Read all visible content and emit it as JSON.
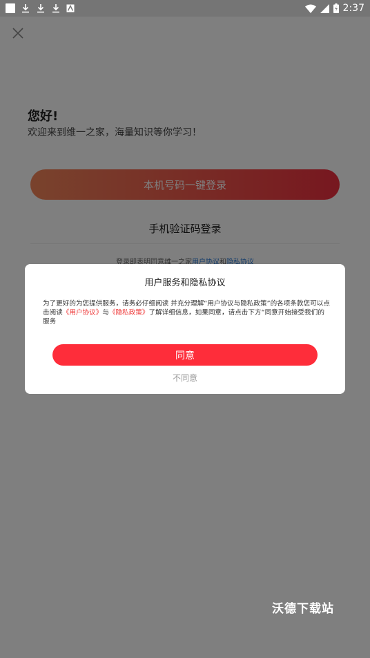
{
  "status_bar": {
    "time": "2:37",
    "icons": [
      "notification-box-icon",
      "download-icon",
      "download-icon",
      "download-icon",
      "image-icon",
      "wifi-icon",
      "signal-icon",
      "battery-icon"
    ]
  },
  "login": {
    "greeting": "您好!",
    "welcome": "欢迎来到维一之家，海量知识等你学习！",
    "one_key_login": "本机号码一键登录",
    "sms_login": "手机验证码登录",
    "agreement_prefix": "登录即表明同意维一之家",
    "user_agreement": "用户协议",
    "and": "和",
    "privacy_policy": "隐私协议"
  },
  "dialog": {
    "title": "用户服务和隐私协议",
    "body_1": "为了更好的为您提供服务，请务必仔细阅读 并充分理解“用户协议与隐私政策”的各项条款您可以点击阅读",
    "link_user": "《用户协议》",
    "body_2": "与",
    "link_privacy": "《隐私政策》",
    "body_3": "了解详细信息，如果同意，请点击下方“同意开始接受我们的服务",
    "agree": "同意",
    "disagree": "不同意"
  },
  "watermark": "沃德下载站",
  "colors": {
    "accent": "#fe2d3a",
    "link_red": "#ee3333",
    "link_blue": "#2b7bd6"
  }
}
